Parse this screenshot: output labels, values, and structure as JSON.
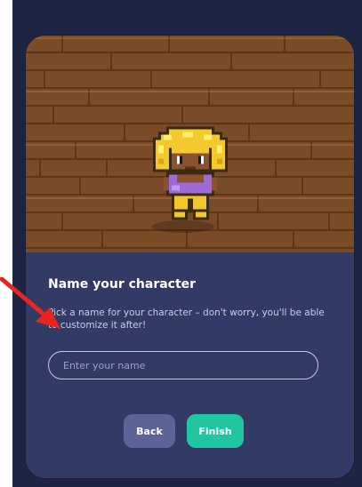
{
  "dialog": {
    "title": "Name your character",
    "description": "Pick a name for your character – don't worry, you'll be able to customize it after!",
    "name_input": {
      "placeholder": "Enter your name",
      "value": ""
    },
    "back_label": "Back",
    "finish_label": "Finish"
  },
  "colors": {
    "background": "#1e2444",
    "card": "#323a66",
    "floor": "#7a4b27",
    "back_button": "#5c6497",
    "finish_button": "#1fc6a0",
    "annotation_arrow": "#e8261f"
  },
  "icons": {
    "annotation": "red-arrow-icon",
    "avatar": "pixel-character-icon"
  }
}
